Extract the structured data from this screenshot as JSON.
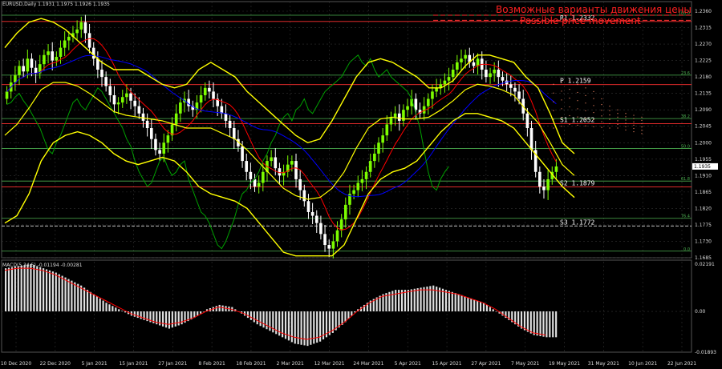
{
  "header": {
    "symbol_line": "EURUSD,Daily  1.1931 1.1975 1.1926 1.1935"
  },
  "annotations": {
    "ru": "Возможные варианты движения цены",
    "en": "Possible price movement"
  },
  "macd_panel": {
    "title": "MACD(5,34,5) -0.01194 -0.00281"
  },
  "colors": {
    "background": "#000000",
    "grid": "#333333",
    "bull_candle": "#7cfc00",
    "bear_candle": "#ffffff",
    "bollinger": "#ffff00",
    "kijun": "#0000ff",
    "tenkan": "#ff0000",
    "chikou": "#00a000",
    "cloud_bull": "#b0b0b0",
    "cloud_bear": "#ff8c69",
    "level_red": "#ff3030",
    "level_green": "#4caf50",
    "level_white": "#dcdcdc",
    "macd_bars": "#e0e0e0",
    "macd_signal": "#ff0000",
    "annotation": "#ff2020"
  },
  "chart_data": [
    {
      "type": "candlestick",
      "symbol": "EURUSD",
      "timeframe": "Daily",
      "ylim": [
        1.1685,
        1.236
      ],
      "y_ticks": [
        "1.2360",
        "1.2315",
        "1.2270",
        "1.2225",
        "1.2180",
        "1.2135",
        "1.2090",
        "1.2045",
        "1.2000",
        "1.1955",
        "1.1910",
        "1.1865",
        "1.1820",
        "1.1775",
        "1.1730",
        "1.1685"
      ],
      "x_ticks": [
        "10 Dec 2020",
        "22 Dec 2020",
        "5 Jan 2021",
        "15 Jan 2021",
        "27 Jan 2021",
        "8 Feb 2021",
        "18 Feb 2021",
        "2 Mar 2021",
        "12 Mar 2021",
        "24 Mar 2021",
        "5 Apr 2021",
        "15 Apr 2021",
        "27 Apr 2021",
        "7 May 2021",
        "19 May 2021",
        "31 May 2021",
        "10 Jun 2021",
        "22 Jun 2021"
      ],
      "current_price": "1.1935",
      "close_path": [
        1.214,
        1.2165,
        1.2185,
        1.221,
        1.2195,
        1.223,
        1.2205,
        1.219,
        1.2215,
        1.224,
        1.225,
        1.2225,
        1.2235,
        1.226,
        1.228,
        1.229,
        1.23,
        1.231,
        1.233,
        1.23,
        1.226,
        1.223,
        1.22,
        1.218,
        1.2155,
        1.213,
        1.2105,
        1.211,
        1.2125,
        1.2135,
        1.2115,
        1.21,
        1.208,
        1.206,
        1.204,
        1.201,
        1.198,
        1.197,
        1.2,
        1.202,
        1.205,
        1.208,
        1.211,
        1.212,
        1.21,
        1.209,
        1.211,
        1.213,
        1.215,
        1.214,
        1.212,
        1.21,
        1.208,
        1.206,
        1.204,
        1.201,
        1.199,
        1.195,
        1.192,
        1.19,
        1.188,
        1.189,
        1.192,
        1.195,
        1.196,
        1.193,
        1.191,
        1.192,
        1.194,
        1.195,
        1.19,
        1.187,
        1.184,
        1.181,
        1.18,
        1.178,
        1.175,
        1.172,
        1.171,
        1.173,
        1.176,
        1.179,
        1.183,
        1.186,
        1.187,
        1.189,
        1.19,
        1.192,
        1.195,
        1.197,
        1.2,
        1.202,
        1.205,
        1.207,
        1.208,
        1.206,
        1.209,
        1.21,
        1.212,
        1.209,
        1.208,
        1.21,
        1.212,
        1.214,
        1.215,
        1.216,
        1.217,
        1.218,
        1.22,
        1.222,
        1.223,
        1.224,
        1.222,
        1.221,
        1.223,
        1.22,
        1.218,
        1.219,
        1.22,
        1.218,
        1.217,
        1.216,
        1.215,
        1.214,
        1.212,
        1.208,
        1.204,
        1.198,
        1.192,
        1.188,
        1.187,
        1.19,
        1.192,
        1.1935
      ],
      "bollinger_upper": [
        1.226,
        1.23,
        1.233,
        1.234,
        1.233,
        1.231,
        1.228,
        1.225,
        1.222,
        1.22,
        1.22,
        1.22,
        1.218,
        1.216,
        1.215,
        1.216,
        1.22,
        1.222,
        1.22,
        1.218,
        1.214,
        1.211,
        1.208,
        1.205,
        1.202,
        1.2,
        1.201,
        1.206,
        1.212,
        1.218,
        1.222,
        1.223,
        1.222,
        1.22,
        1.218,
        1.215,
        1.215,
        1.217,
        1.221,
        1.224,
        1.224,
        1.223,
        1.222,
        1.218,
        1.215,
        1.208,
        1.2,
        1.197
      ],
      "bollinger_lower": [
        1.178,
        1.18,
        1.186,
        1.195,
        1.2,
        1.202,
        1.203,
        1.202,
        1.2,
        1.197,
        1.195,
        1.194,
        1.195,
        1.196,
        1.195,
        1.192,
        1.188,
        1.186,
        1.185,
        1.184,
        1.182,
        1.178,
        1.174,
        1.17,
        1.169,
        1.169,
        1.169,
        1.169,
        1.172,
        1.179,
        1.186,
        1.19,
        1.192,
        1.193,
        1.195,
        1.199,
        1.203,
        1.206,
        1.208,
        1.208,
        1.207,
        1.206,
        1.204,
        1.2,
        1.196,
        1.192,
        1.188,
        1.185
      ],
      "levels": [
        {
          "name": "R1",
          "label": "R1  1.2332",
          "value": 1.2332,
          "color": "#ff3030"
        },
        {
          "name": "P",
          "label": "P  1.2159",
          "value": 1.2159,
          "color": "#ff3030"
        },
        {
          "name": "S1",
          "label": "S1  1.2052",
          "value": 1.2052,
          "color": "#ff3030"
        },
        {
          "name": "S2",
          "label": "S2  1.1879",
          "value": 1.1879,
          "color": "#ff3030"
        },
        {
          "name": "S3",
          "label": "S3  1.1772",
          "value": 1.1772,
          "color": "#dcdcdc"
        }
      ],
      "fib_levels": [
        {
          "label": "100.0",
          "value": 1.2349
        },
        {
          "label": "23.6",
          "value": 1.2185
        },
        {
          "label": "38.2",
          "value": 1.2066
        },
        {
          "label": "50.0",
          "value": 1.1984
        },
        {
          "label": "61.8",
          "value": 1.1895
        },
        {
          "label": "76.4",
          "value": 1.1793
        },
        {
          "label": "0.0",
          "value": 1.1703
        }
      ]
    },
    {
      "type": "bar",
      "name": "MACD(5,34,5)",
      "value_main": "-0.01194",
      "value_signal": "-0.00281",
      "ylim": [
        -0.01893,
        0.02191
      ],
      "y_ticks": [
        "0.02191",
        "0.00",
        "-0.01893"
      ],
      "histogram_path": [
        0.02,
        0.021,
        0.022,
        0.02,
        0.018,
        0.015,
        0.012,
        0.008,
        0.004,
        0.001,
        -0.002,
        -0.004,
        -0.006,
        -0.008,
        -0.006,
        -0.003,
        0.001,
        0.003,
        0.002,
        -0.002,
        -0.006,
        -0.009,
        -0.012,
        -0.015,
        -0.016,
        -0.014,
        -0.01,
        -0.005,
        0.001,
        0.005,
        0.008,
        0.01,
        0.01,
        0.011,
        0.012,
        0.01,
        0.008,
        0.006,
        0.004,
        0.0,
        -0.004,
        -0.008,
        -0.011,
        -0.012
      ],
      "signal_path": [
        0.019,
        0.02,
        0.02,
        0.019,
        0.017,
        0.014,
        0.011,
        0.008,
        0.005,
        0.002,
        -0.001,
        -0.003,
        -0.005,
        -0.006,
        -0.005,
        -0.003,
        0.0,
        0.002,
        0.001,
        -0.001,
        -0.004,
        -0.007,
        -0.01,
        -0.012,
        -0.013,
        -0.012,
        -0.009,
        -0.005,
        0.0,
        0.004,
        0.007,
        0.008,
        0.009,
        0.01,
        0.01,
        0.009,
        0.008,
        0.006,
        0.004,
        0.001,
        -0.003,
        -0.007,
        -0.01,
        -0.011
      ]
    }
  ]
}
